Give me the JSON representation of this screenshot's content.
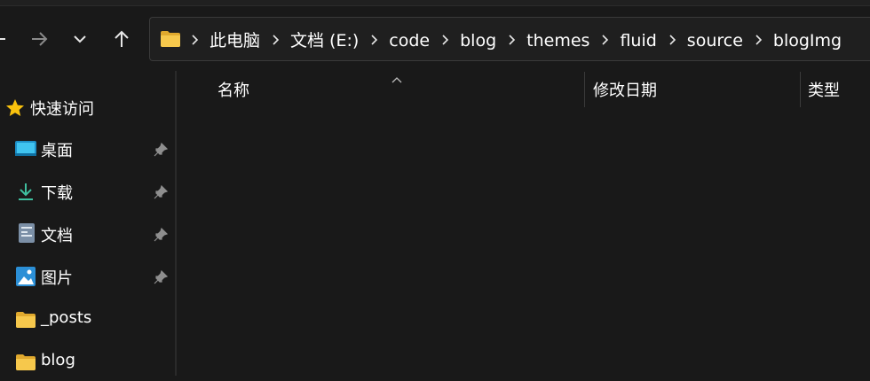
{
  "toolbar": {
    "back_icon": "arrow-left-icon",
    "forward_icon": "arrow-right-icon",
    "recent_icon": "chevron-down-icon",
    "up_icon": "arrow-up-icon"
  },
  "address_bar": {
    "root_icon": "folder-icon",
    "crumbs": [
      "此电脑",
      "文档 (E:)",
      "code",
      "blog",
      "themes",
      "fluid",
      "source",
      "blogImg"
    ]
  },
  "columns": {
    "name": "名称",
    "modified": "修改日期",
    "type": "类型",
    "sort_icon": "sort-ascending-icon"
  },
  "sidebar": {
    "quick_access": {
      "label": "快速访问",
      "icon": "star-icon"
    },
    "items": [
      {
        "label": "桌面",
        "icon": "desktop-icon",
        "pinned": true
      },
      {
        "label": "下载",
        "icon": "download-icon",
        "pinned": true
      },
      {
        "label": "文档",
        "icon": "document-icon",
        "pinned": true
      },
      {
        "label": "图片",
        "icon": "pictures-icon",
        "pinned": true
      },
      {
        "label": "_posts",
        "icon": "folder-icon",
        "pinned": false
      },
      {
        "label": "blog",
        "icon": "folder-icon",
        "pinned": false
      }
    ]
  },
  "colors": {
    "background": "#191919",
    "text": "#ffffff",
    "folder_yellow": "#f4c542",
    "star_yellow": "#f9c20d",
    "download_green": "#3fbf9f"
  }
}
